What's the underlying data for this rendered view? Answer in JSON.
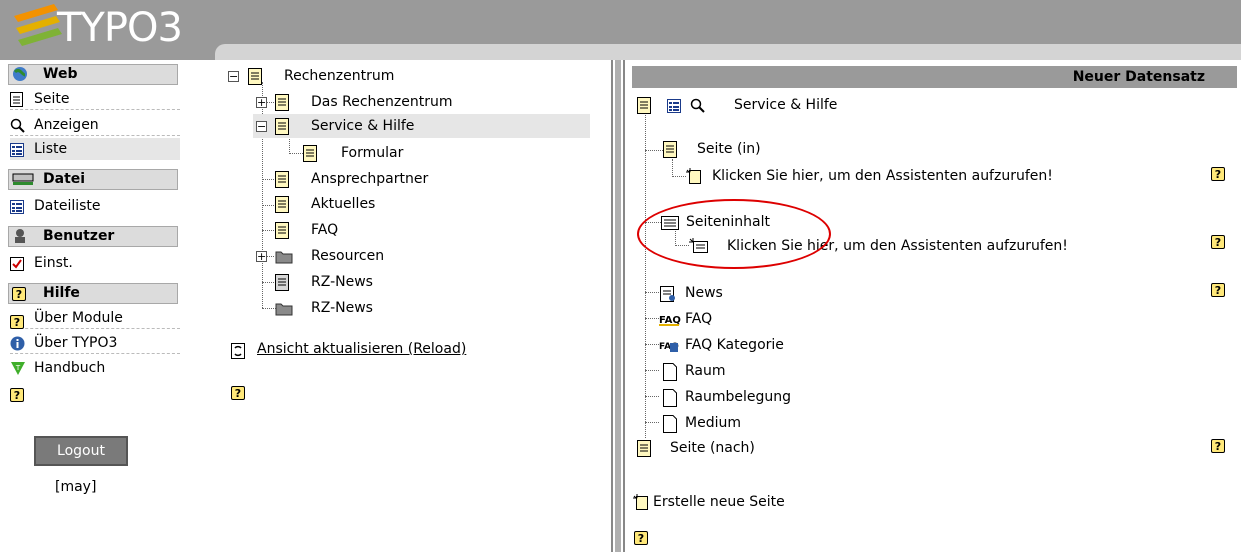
{
  "header": {
    "logo_text": "TYPO3"
  },
  "menu": {
    "sections": [
      {
        "label": "Web",
        "icon": "globe-icon"
      },
      {
        "label": "Datei",
        "icon": "drive-icon"
      },
      {
        "label": "Benutzer",
        "icon": "user-icon"
      },
      {
        "label": "Hilfe",
        "icon": "help-icon"
      }
    ],
    "items": [
      {
        "label": "Seite",
        "icon": "page-icon"
      },
      {
        "label": "Anzeigen",
        "icon": "magnifier-icon"
      },
      {
        "label": "Liste",
        "icon": "list-icon"
      },
      {
        "label": "Dateiliste",
        "icon": "list-icon"
      },
      {
        "label": "Einst.",
        "icon": "checkbox-icon"
      },
      {
        "label": "Über Module",
        "icon": "help-icon"
      },
      {
        "label": "Über TYPO3",
        "icon": "info-icon"
      },
      {
        "label": "Handbuch",
        "icon": "manual-icon"
      }
    ],
    "logout_label": "Logout",
    "user": "[may]"
  },
  "tree": {
    "nodes": [
      {
        "label": "Rechenzentrum"
      },
      {
        "label": "Das Rechenzentrum"
      },
      {
        "label": "Service & Hilfe"
      },
      {
        "label": "Formular"
      },
      {
        "label": "Ansprechpartner"
      },
      {
        "label": "Aktuelles"
      },
      {
        "label": "FAQ"
      },
      {
        "label": "Resourcen"
      },
      {
        "label": "RZ-News"
      },
      {
        "label": "RZ-News"
      }
    ],
    "reload_label": "Ansicht aktualisieren (Reload)"
  },
  "content": {
    "title": "Neuer Datensatz",
    "page_title": "Service & Hilfe",
    "page_in": "Seite (in)",
    "wizard1": "Klicken Sie hier, um den Assistenten aufzurufen!",
    "content_label": "Seiteninhalt",
    "wizard2": "Klicken Sie hier, um den Assistenten aufzurufen!",
    "records": [
      "News",
      "FAQ",
      "FAQ Kategorie",
      "Raum",
      "Raumbelegung",
      "Medium"
    ],
    "page_after": "Seite (nach)",
    "create_page": "Erstelle neue Seite",
    "help_mark": "?"
  },
  "colors": {
    "topbar": "#9a9a9a",
    "highlight": "#dd0000",
    "selected": "#e6e6e6"
  }
}
